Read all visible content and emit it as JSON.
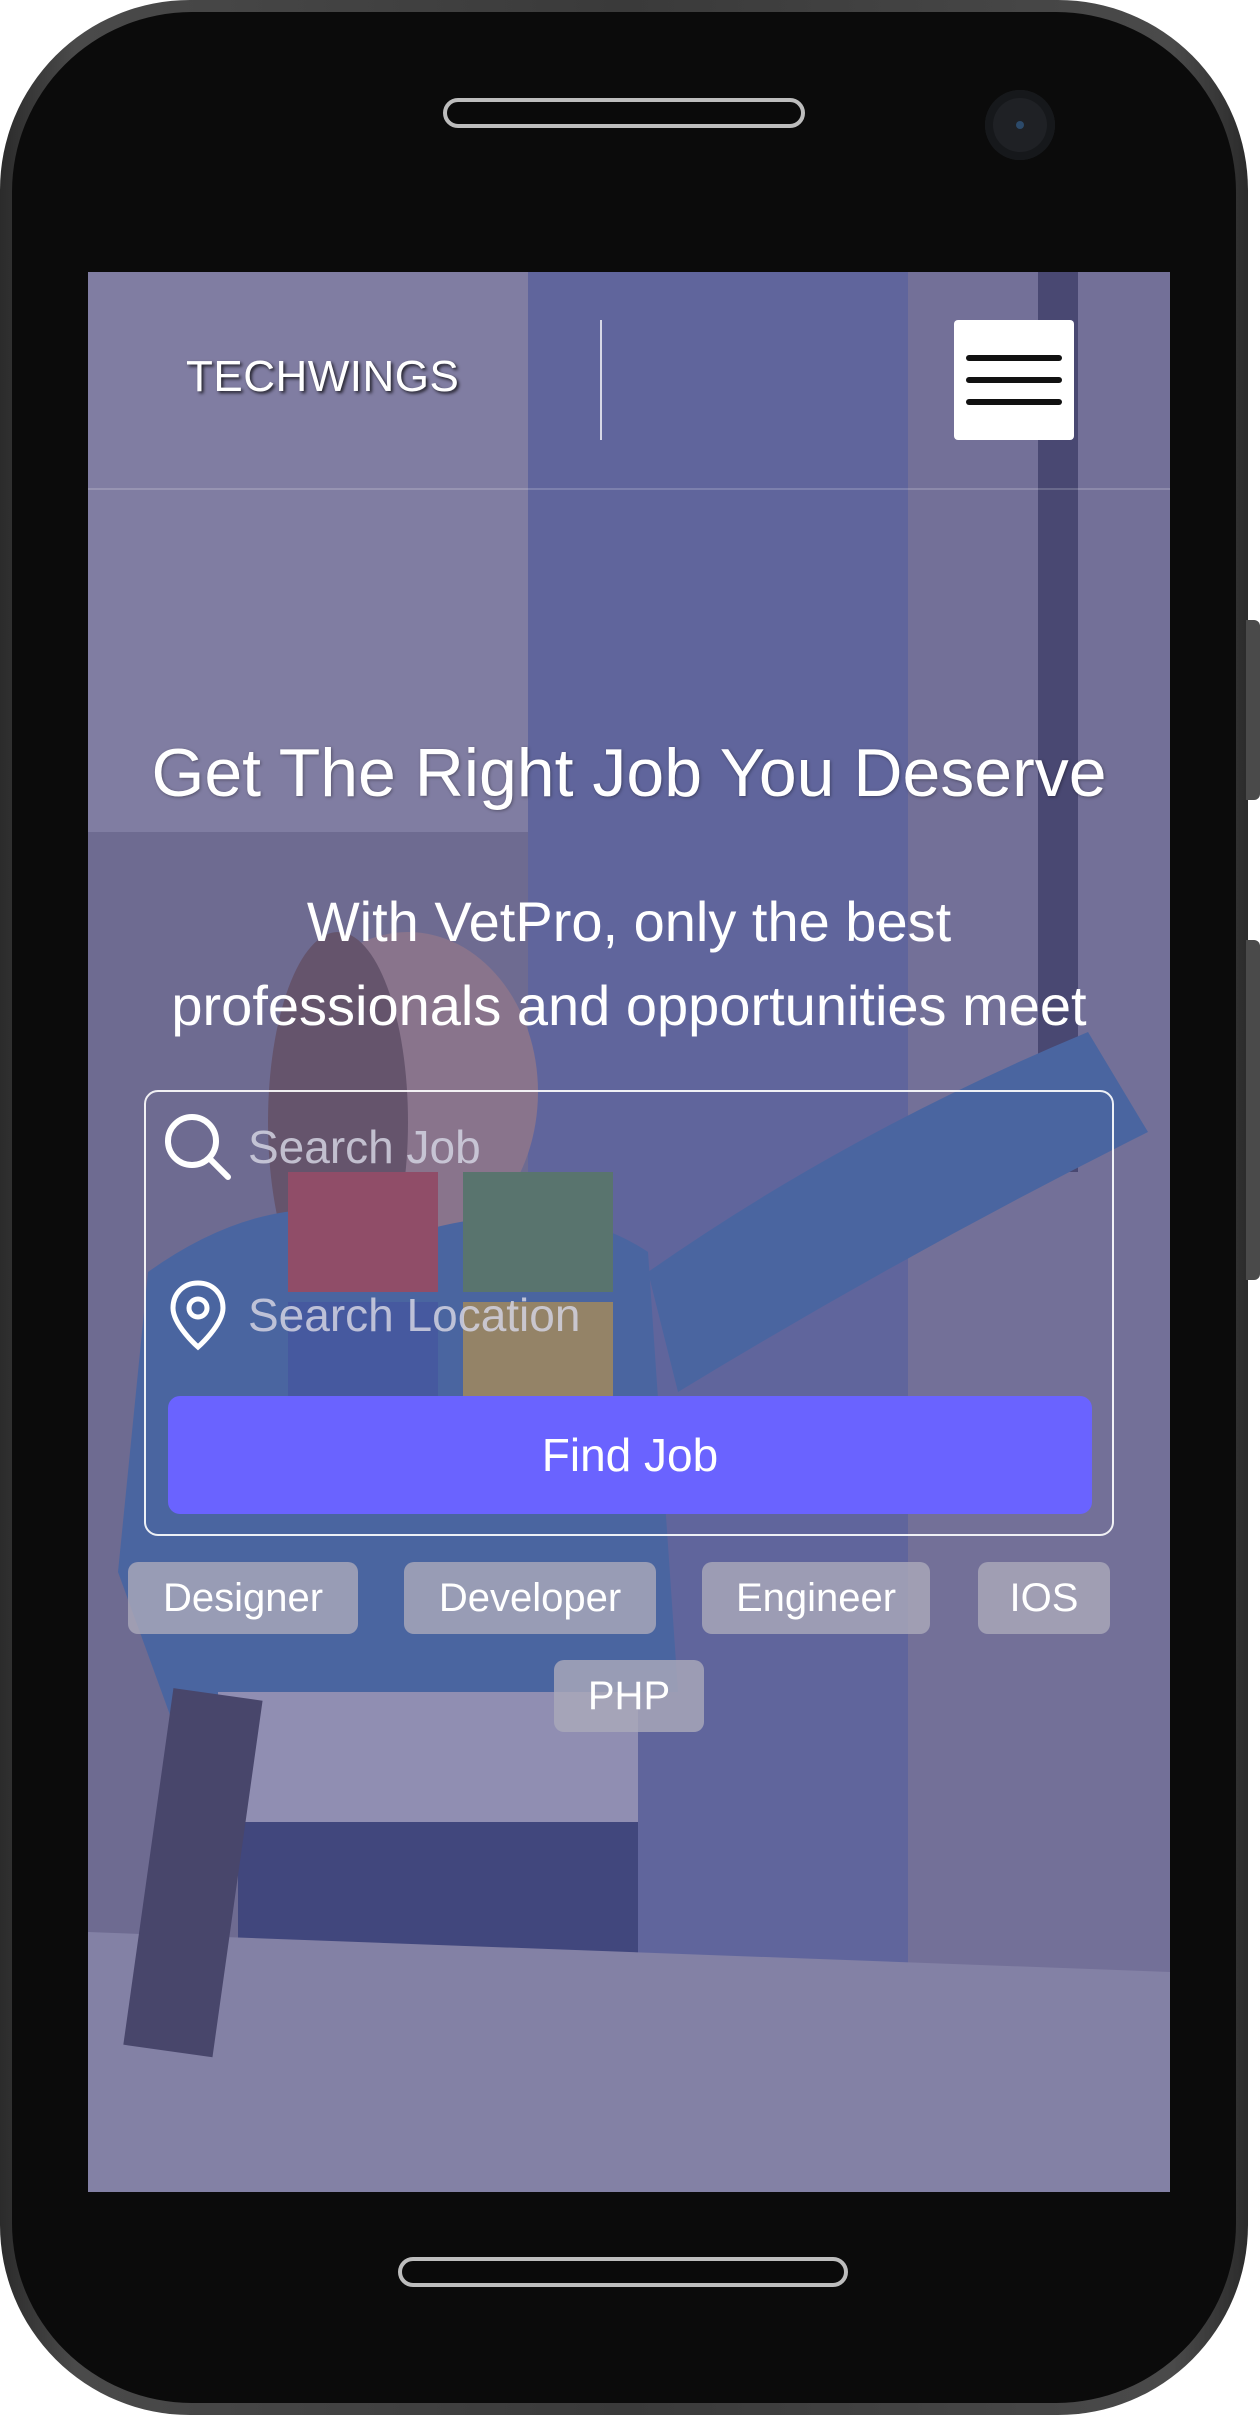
{
  "header": {
    "brand": "TECHWINGS",
    "menu_icon": "hamburger-menu-icon"
  },
  "hero": {
    "title": "Get The Right Job You Deserve",
    "subtitle_line1": "With VetPro, only the best",
    "subtitle_line2": "professionals and opportunities meet"
  },
  "search": {
    "job_placeholder": "Search Job",
    "job_value": "",
    "location_placeholder": "Search Location",
    "location_value": "",
    "job_icon": "search-icon",
    "location_icon": "map-pin-icon",
    "button_label": "Find Job"
  },
  "tags": [
    "Designer",
    "Developer",
    "Engineer",
    "IOS",
    "PHP"
  ],
  "colors": {
    "accent": "#6a63ff",
    "overlay": "#54508c",
    "tag_bg": "#aaa8b9"
  }
}
